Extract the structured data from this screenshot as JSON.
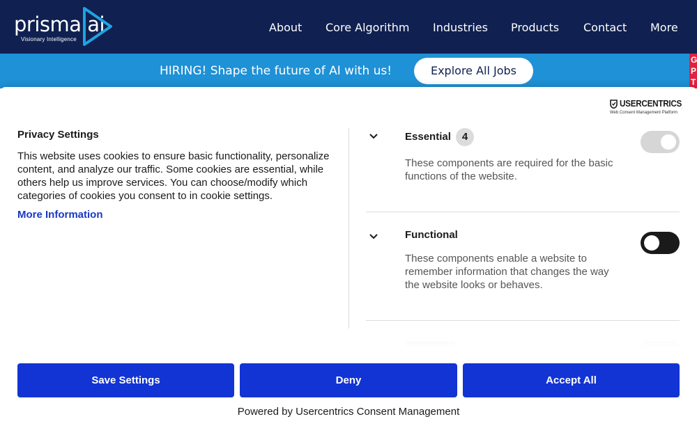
{
  "header": {
    "logo_word": "prisma.ai",
    "logo_tagline": "Visionary Intelligence",
    "nav": [
      "About",
      "Core Algorithm",
      "Industries",
      "Products",
      "Contact",
      "More"
    ]
  },
  "banner": {
    "text": "HIRING!  Shape the future of AI with us!",
    "button_label": "Explore All Jobs",
    "side_letters": [
      "G",
      "P",
      "T"
    ]
  },
  "consent": {
    "brand_name": "USERCENTRICS",
    "brand_sub": "Web Consent Management Platform",
    "title": "Privacy Settings",
    "description": "This website uses cookies to ensure basic functionality, personalize content, and analyze our traffic. Some cookies are essential, while others help us improve services. You can choose/modify which categories of cookies you consent to in cookie settings.",
    "more_info": "More Information",
    "categories": [
      {
        "name": "Essential",
        "count": "4",
        "description": "These components are required for the basic functions of the website.",
        "enabled": true,
        "locked": true
      },
      {
        "name": "Functional",
        "description": "These components enable a website to remember information that changes the way the website looks or behaves.",
        "enabled": false,
        "locked": false
      }
    ],
    "buttons": {
      "save": "Save Settings",
      "deny": "Deny",
      "accept": "Accept All"
    },
    "powered_by": "Powered by Usercentrics Consent Management"
  },
  "colors": {
    "header_bg": "#0f2051",
    "banner_bg": "#1f91d6",
    "logo_accent": "#1fa3e0",
    "button_bg": "#1234d4",
    "link": "#1938c6",
    "toggle_on_locked": "#d6d6d6",
    "toggle_off": "#1a1a1a"
  }
}
